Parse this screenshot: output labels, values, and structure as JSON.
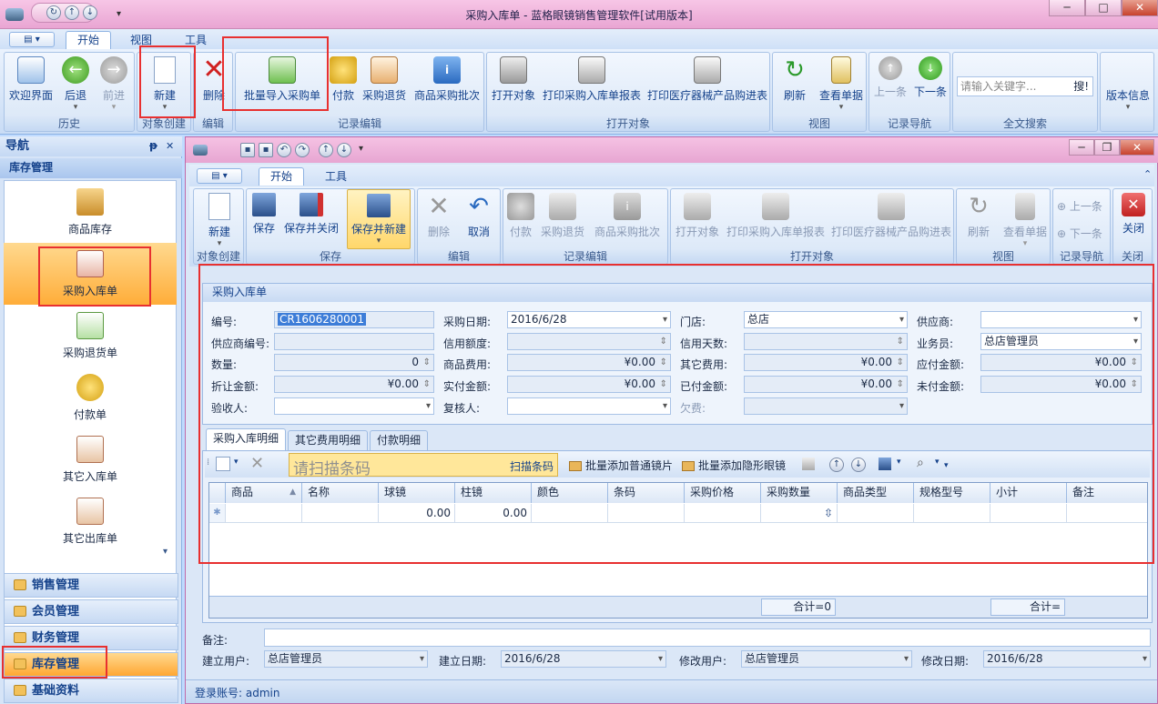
{
  "window": {
    "title": "采购入库单 - 蓝格眼镜销售管理软件[试用版本]"
  },
  "main_tabs": [
    {
      "label": "开始",
      "active": true
    },
    {
      "label": "视图",
      "active": false
    },
    {
      "label": "工具",
      "active": false
    }
  ],
  "ribbon": {
    "buttons": {
      "welcome": "欢迎界面",
      "back": "后退",
      "forward": "前进",
      "new": "新建",
      "delete": "删除",
      "batch_import": "批量导入采购单",
      "payment": "付款",
      "purchase_return": "采购退货",
      "batch_query": "商品采购批次",
      "open_object": "打开对象",
      "print_report": "打印采购入库单报表",
      "print_device": "打印医疗器械产品购进表",
      "refresh": "刷新",
      "view_doc": "查看单据",
      "prev": "上一条",
      "next": "下一条",
      "version": "版本信息"
    },
    "groups": {
      "history": "历史",
      "object_create": "对象创建",
      "edit": "编辑",
      "record_edit": "记录编辑",
      "open_object": "打开对象",
      "view": "视图",
      "record_nav": "记录导航",
      "fulltext": "全文搜索"
    },
    "search_placeholder": "请输入关键字...",
    "search_button": "搜!"
  },
  "nav": {
    "title": "导航",
    "pin": "ᵽ",
    "close": "✕",
    "current_group": "库存管理",
    "items": [
      {
        "label": "商品库存",
        "active": false
      },
      {
        "label": "采购入库单",
        "active": true
      },
      {
        "label": "采购退货单",
        "active": false
      },
      {
        "label": "付款单",
        "active": false
      },
      {
        "label": "其它入库单",
        "active": false
      },
      {
        "label": "其它出库单",
        "active": false
      }
    ],
    "groups": [
      {
        "label": "销售管理",
        "active": false
      },
      {
        "label": "会员管理",
        "active": false
      },
      {
        "label": "财务管理",
        "active": false
      },
      {
        "label": "库存管理",
        "active": true
      },
      {
        "label": "基础资料",
        "active": false
      }
    ]
  },
  "child": {
    "tabs": [
      {
        "label": "开始",
        "active": true
      },
      {
        "label": "工具",
        "active": false
      }
    ],
    "buttons": {
      "new": "新建",
      "save": "保存",
      "save_close": "保存并关闭",
      "save_new": "保存并新建",
      "delete": "删除",
      "undo": "取消",
      "payment": "付款",
      "purchase_return": "采购退货",
      "batch_query": "商品采购批次",
      "open_object": "打开对象",
      "print_report": "打印采购入库单报表",
      "print_device": "打印医疗器械产品购进表",
      "refresh": "刷新",
      "view_doc": "查看单据",
      "prev": "上一条",
      "next": "下一条",
      "close": "关闭"
    },
    "groups": {
      "object_create": "对象创建",
      "save": "保存",
      "edit": "编辑",
      "record_edit": "记录编辑",
      "open_object": "打开对象",
      "view": "视图",
      "record_nav": "记录导航",
      "close": "关闭"
    },
    "form_title": "采购入库单",
    "fields": {
      "code": {
        "label": "编号:",
        "value": "CR1606280001"
      },
      "purchase_date": {
        "label": "采购日期:",
        "value": "2016/6/28"
      },
      "store": {
        "label": "门店:",
        "value": "总店"
      },
      "supplier": {
        "label": "供应商:",
        "value": ""
      },
      "supplier_code": {
        "label": "供应商编号:",
        "value": ""
      },
      "credit_limit": {
        "label": "信用额度:",
        "value": ""
      },
      "credit_days": {
        "label": "信用天数:",
        "value": ""
      },
      "salesman": {
        "label": "业务员:",
        "value": "总店管理员"
      },
      "quantity": {
        "label": "数量:",
        "value": "0"
      },
      "goods_cost": {
        "label": "商品费用:",
        "value": "¥0.00"
      },
      "other_cost": {
        "label": "其它费用:",
        "value": "¥0.00"
      },
      "payable": {
        "label": "应付金额:",
        "value": "¥0.00"
      },
      "discount": {
        "label": "折让金额:",
        "value": "¥0.00"
      },
      "actual_paid": {
        "label": "实付金额:",
        "value": "¥0.00"
      },
      "paid": {
        "label": "已付金额:",
        "value": "¥0.00"
      },
      "unpaid": {
        "label": "未付金额:",
        "value": "¥0.00"
      },
      "receiver": {
        "label": "验收人:",
        "value": ""
      },
      "reviewer": {
        "label": "复核人:",
        "value": ""
      },
      "owed": {
        "label": "欠费:",
        "value": ""
      }
    },
    "detail_tabs": [
      {
        "label": "采购入库明细",
        "active": true
      },
      {
        "label": "其它费用明细",
        "active": false
      },
      {
        "label": "付款明细",
        "active": false
      }
    ],
    "toolbar": {
      "scan_placeholder": "请扫描条码",
      "scan_button": "扫描条码",
      "batch_normal": "批量添加普通镜片",
      "batch_contact": "批量添加隐形眼镜"
    },
    "grid": {
      "columns": [
        "商品",
        "名称",
        "球镜",
        "柱镜",
        "颜色",
        "条码",
        "采购价格",
        "采购数量",
        "商品类型",
        "规格型号",
        "小计",
        "备注"
      ],
      "rows": [
        [
          "",
          "",
          "0.00",
          "0.00",
          "",
          "",
          "",
          "",
          "",
          "",
          "",
          ""
        ]
      ],
      "sum_qty": "合计=0",
      "sum_total": "合计="
    },
    "remark_label": "备注:",
    "footer": {
      "create_user_label": "建立用户:",
      "create_user": "总店管理员",
      "create_date_label": "建立日期:",
      "create_date": "2016/6/28",
      "modify_user_label": "修改用户:",
      "modify_user": "总店管理员",
      "modify_date_label": "修改日期:",
      "modify_date": "2016/6/28"
    },
    "status": "登录账号: admin"
  },
  "colors": {
    "highlight": "#e83030",
    "nav_active": "#ffad39",
    "ribbon_bg": "#dde9f8",
    "title_pink": "#e9a5d3"
  }
}
